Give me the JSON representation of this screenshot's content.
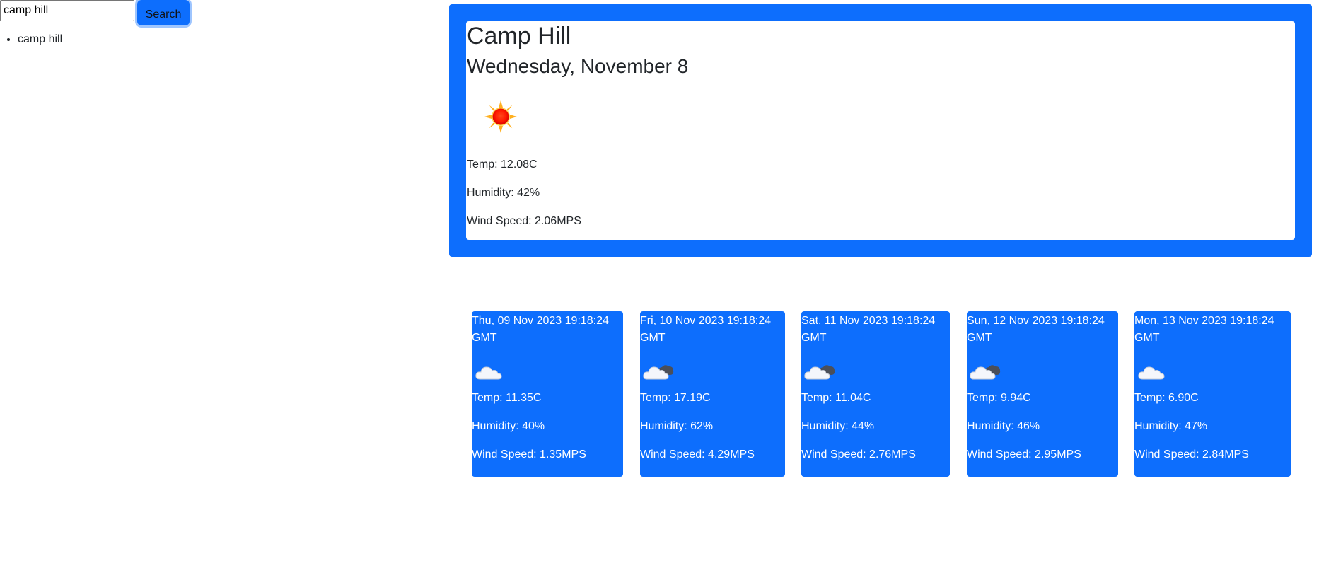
{
  "search": {
    "value": "camp hill",
    "button_label": "Search"
  },
  "history": [
    "camp hill"
  ],
  "current": {
    "city": "Camp Hill",
    "date": "Wednesday, November 8",
    "icon": "sun-icon",
    "temp": "Temp: 12.08C",
    "humidity": "Humidity: 42%",
    "wind": "Wind Speed: 2.06MPS"
  },
  "forecast": [
    {
      "date": "Thu, 09 Nov 2023 19:18:24 GMT",
      "icon": "cloud-icon",
      "temp": "Temp: 11.35C",
      "humidity": "Humidity: 40%",
      "wind": "Wind Speed: 1.35MPS"
    },
    {
      "date": "Fri, 10 Nov 2023 19:18:24 GMT",
      "icon": "cloudy-icon",
      "temp": "Temp: 17.19C",
      "humidity": "Humidity: 62%",
      "wind": "Wind Speed: 4.29MPS"
    },
    {
      "date": "Sat, 11 Nov 2023 19:18:24 GMT",
      "icon": "cloudy-icon",
      "temp": "Temp: 11.04C",
      "humidity": "Humidity: 44%",
      "wind": "Wind Speed: 2.76MPS"
    },
    {
      "date": "Sun, 12 Nov 2023 19:18:24 GMT",
      "icon": "cloudy-icon",
      "temp": "Temp: 9.94C",
      "humidity": "Humidity: 46%",
      "wind": "Wind Speed: 2.95MPS"
    },
    {
      "date": "Mon, 13 Nov 2023 19:18:24 GMT",
      "icon": "cloud-icon",
      "temp": "Temp: 6.90C",
      "humidity": "Humidity: 47%",
      "wind": "Wind Speed: 2.84MPS"
    }
  ],
  "colors": {
    "accent": "#0d6efd",
    "card_text": "#ffffff",
    "body_text": "#212529"
  }
}
